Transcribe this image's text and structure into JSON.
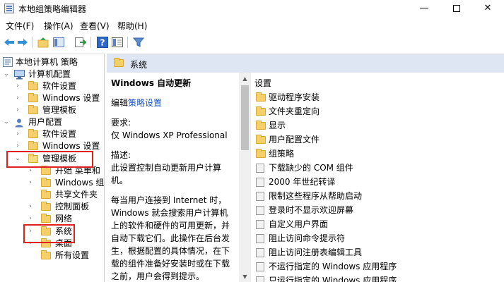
{
  "window": {
    "title": "本地组策略编辑器",
    "min_label": "—",
    "close_label": "✕"
  },
  "menu": {
    "items": [
      "文件(F)",
      "操作(A)",
      "查看(V)",
      "帮助(H)"
    ]
  },
  "toolbar": {
    "icons": [
      "back-arrow-icon",
      "forward-arrow-icon",
      "up-folder-icon",
      "show-hide-tree-icon",
      "export-list-icon",
      "help-icon",
      "properties-icon",
      "filter-icon"
    ]
  },
  "tree": {
    "root": "本地计算机 策略",
    "computer_config": "计算机配置",
    "cc_software": "软件设置",
    "cc_windows": "Windows 设置",
    "cc_admin": "管理模板",
    "user_config": "用户配置",
    "uc_software": "软件设置",
    "uc_windows": "Windows 设置",
    "uc_admin": "管理模板",
    "uc_start_menu": "开始 菜单和",
    "uc_windows_comp": "Windows 组件",
    "uc_shared": "共享文件夹",
    "uc_control": "控制面板",
    "uc_network": "网络",
    "uc_system": "系统",
    "uc_desktop": "桌面",
    "uc_all": "所有设置"
  },
  "header": {
    "title": "系统"
  },
  "description": {
    "title": "Windows 自动更新",
    "edit_prefix": "编辑",
    "edit_link": "策略设置",
    "req_label": "要求:",
    "req_value": "仅 Windows XP Professional",
    "desc_label": "描述:",
    "desc_value": "此设置控制自动更新用户计算机。",
    "body": "每当用户连接到 Internet 时，Windows 就会搜索用户计算机上的软件和硬件的可用更新，并自动下载它们。此操作在后台发生，根据配置的具体情况，在下载的组件准备好安装时或在下载之前，用户会得到提示。"
  },
  "list": {
    "header": "设置",
    "items": [
      {
        "type": "folder",
        "label": "驱动程序安装"
      },
      {
        "type": "folder",
        "label": "文件夹重定向"
      },
      {
        "type": "folder",
        "label": "显示"
      },
      {
        "type": "folder",
        "label": "用户配置文件"
      },
      {
        "type": "folder",
        "label": "组策略"
      },
      {
        "type": "setting",
        "label": "下载缺少的 COM 组件"
      },
      {
        "type": "setting",
        "label": "2000 年世纪转译"
      },
      {
        "type": "setting",
        "label": "限制这些程序从帮助启动"
      },
      {
        "type": "setting",
        "label": "登录时不显示欢迎屏幕"
      },
      {
        "type": "setting",
        "label": "自定义用户界面"
      },
      {
        "type": "setting",
        "label": "阻止访问命令提示符"
      },
      {
        "type": "setting",
        "label": "阻止访问注册表编辑工具"
      },
      {
        "type": "setting",
        "label": "不运行指定的 Windows 应用程序"
      },
      {
        "type": "setting",
        "label": "只运行指定的 Windows 应用程序"
      }
    ]
  },
  "colors": {
    "highlight_box": "#e02020",
    "folder": "#f5cf6a",
    "header_band": "#dde6f2",
    "link": "#1a55c0"
  }
}
